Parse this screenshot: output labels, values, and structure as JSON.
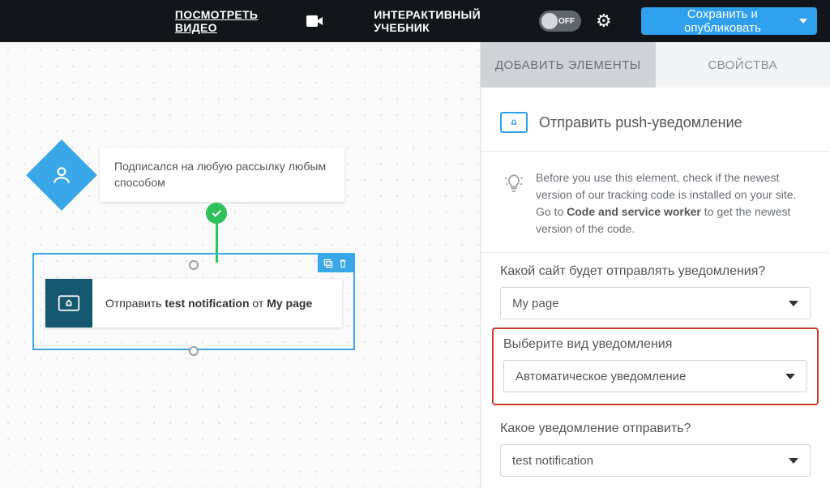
{
  "topbar": {
    "watch_video": "ПОСМОТРЕТЬ ВИДЕО",
    "tutorial_label": "ИНТЕРАКТИВНЫЙ УЧЕБНИК",
    "toggle_state": "OFF",
    "save_publish": "Сохранить и опубликовать"
  },
  "canvas": {
    "trigger_text": "Подписался на любую рассылку любым способом",
    "action_prefix": "Отправить ",
    "action_name": "test notification",
    "action_mid": " от ",
    "action_source": "My page"
  },
  "side": {
    "tabs": {
      "add": "ДОБАВИТЬ ЭЛЕМЕНТЫ",
      "props": "СВОЙСТВА"
    },
    "header_title": "Отправить push-уведомление",
    "hint_before": "Before you use this element, check if the newest version of our tracking code is installed on your site. Go to ",
    "hint_bold": "Code and service worker",
    "hint_after": " to get the newest version of the code.",
    "field1_label": "Какой сайт будет отправлять уведомления?",
    "field1_value": "My page",
    "field2_label": "Выберите вид уведомления",
    "field2_value": "Автоматическое уведомление",
    "field3_label": "Какое уведомление отправить?",
    "field3_value": "test notification"
  }
}
